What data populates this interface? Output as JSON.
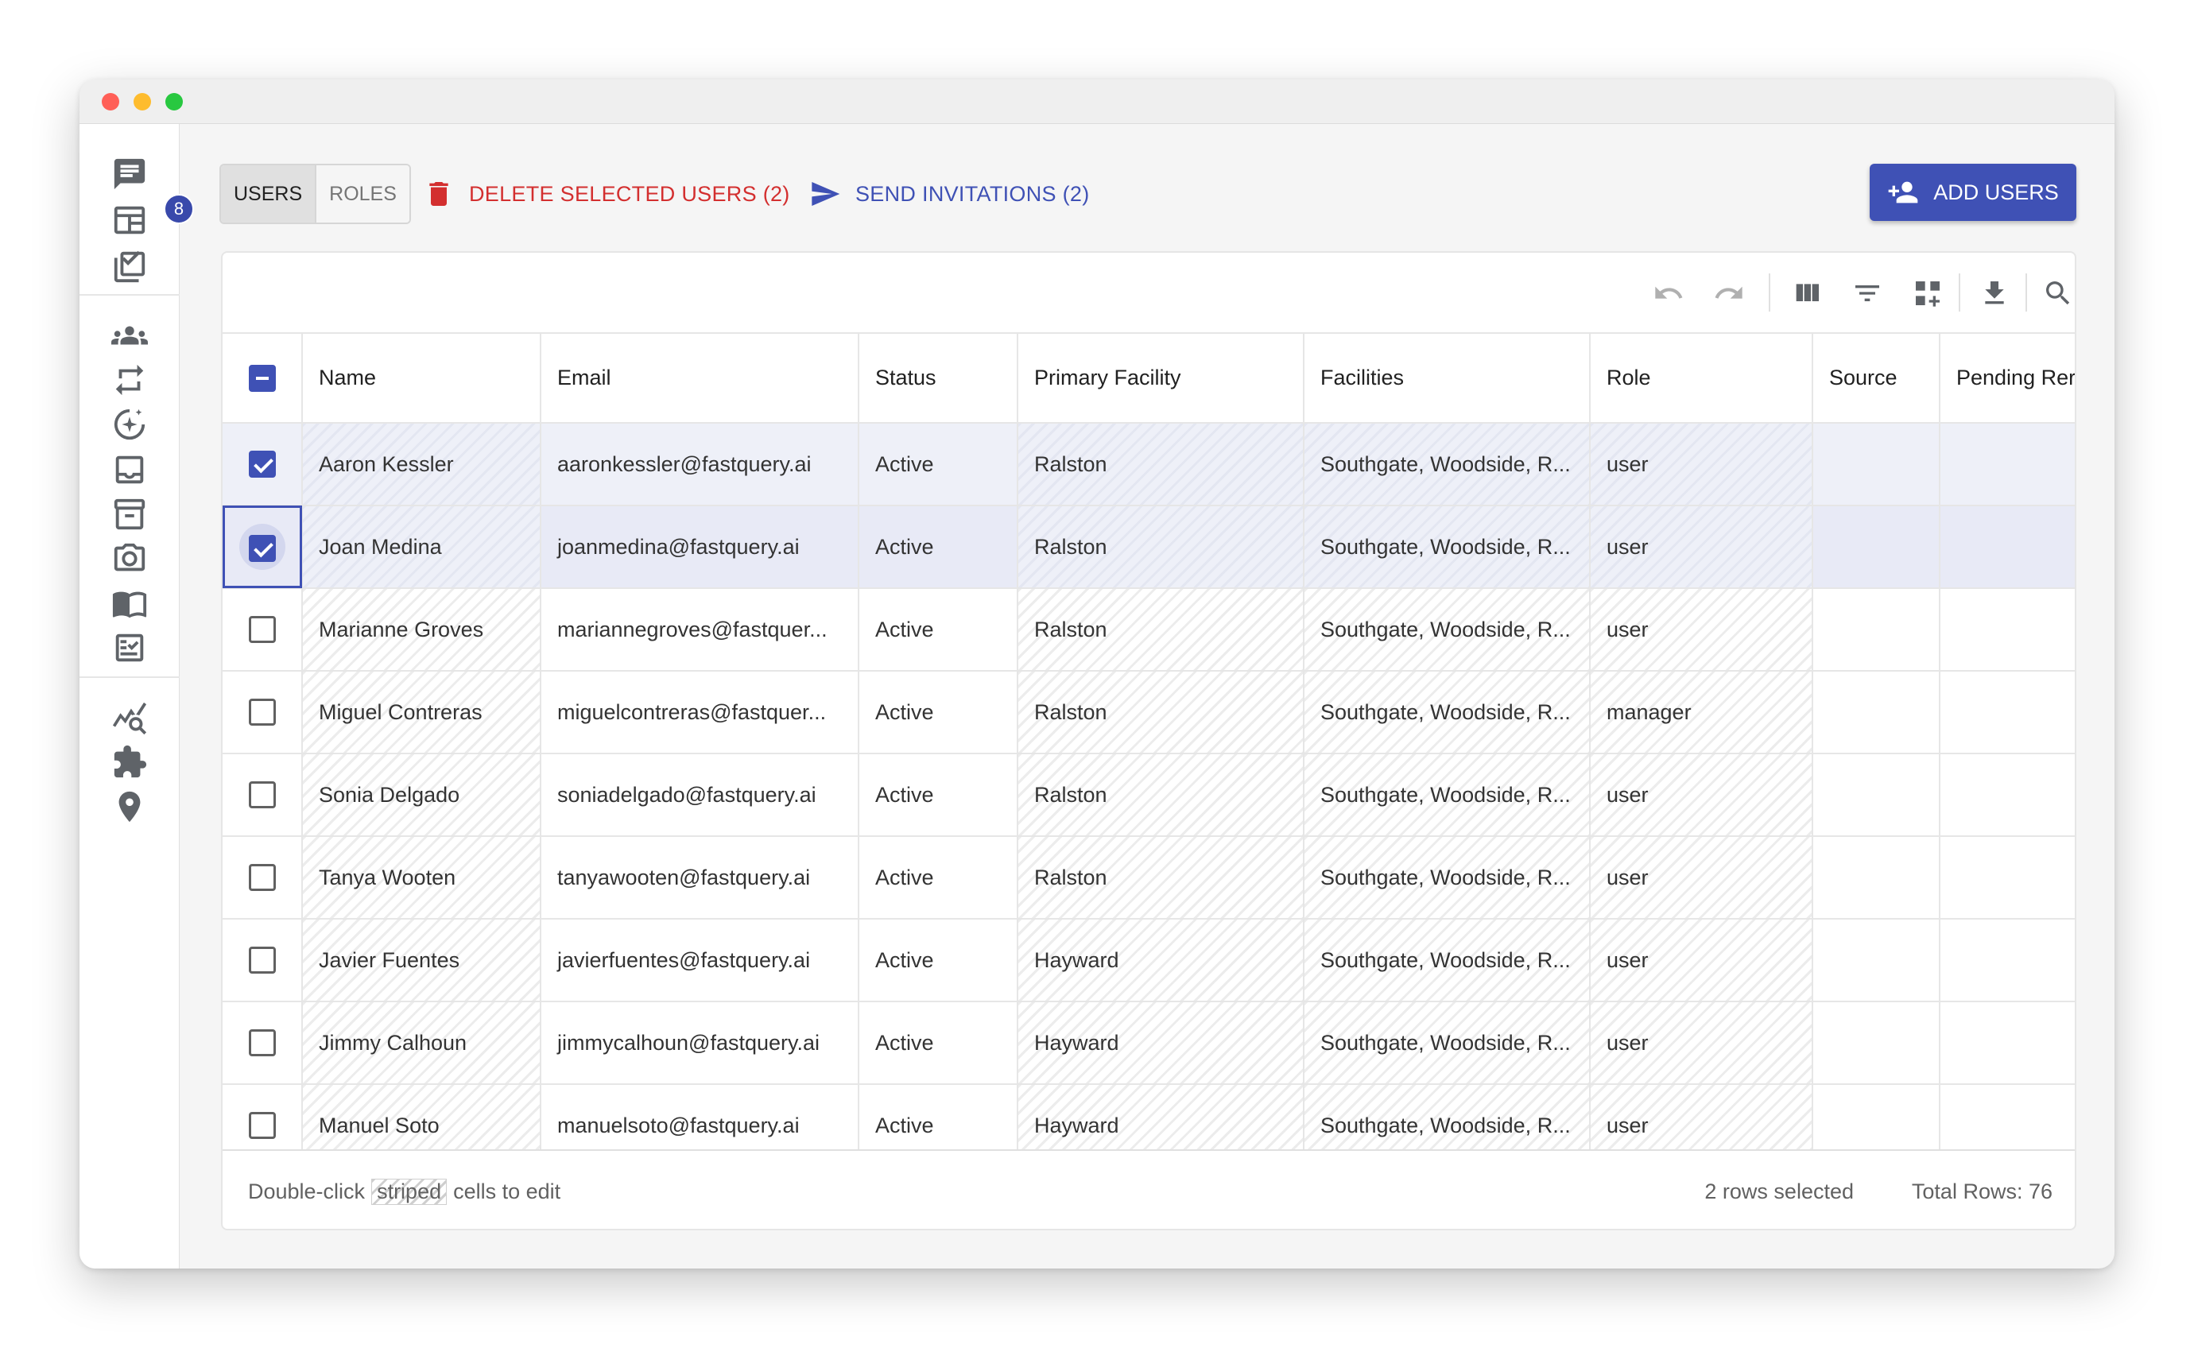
{
  "tabs": {
    "users": "USERS",
    "roles": "ROLES"
  },
  "actions": {
    "delete_label": "DELETE SELECTED USERS (2)",
    "invite_label": "SEND INVITATIONS (2)",
    "add_label": "ADD USERS"
  },
  "sidebar": {
    "badge_count": "8"
  },
  "columns": [
    "Name",
    "Email",
    "Status",
    "Primary Facility",
    "Facilities",
    "Role",
    "Source",
    "Pending Rer"
  ],
  "rows": [
    {
      "name": "Aaron Kessler",
      "email": "aaronkessler@fastquery.ai",
      "status": "Active",
      "primary": "Ralston",
      "facilities": "Southgate, Woodside, R...",
      "role": "user",
      "selected": true
    },
    {
      "name": "Joan Medina",
      "email": "joanmedina@fastquery.ai",
      "status": "Active",
      "primary": "Ralston",
      "facilities": "Southgate, Woodside, R...",
      "role": "user",
      "selected": true
    },
    {
      "name": "Marianne Groves",
      "email": "mariannegroves@fastquer...",
      "status": "Active",
      "primary": "Ralston",
      "facilities": "Southgate, Woodside, R...",
      "role": "user",
      "selected": false
    },
    {
      "name": "Miguel Contreras",
      "email": "miguelcontreras@fastquer...",
      "status": "Active",
      "primary": "Ralston",
      "facilities": "Southgate, Woodside, R...",
      "role": "manager",
      "selected": false
    },
    {
      "name": "Sonia Delgado",
      "email": "soniadelgado@fastquery.ai",
      "status": "Active",
      "primary": "Ralston",
      "facilities": "Southgate, Woodside, R...",
      "role": "user",
      "selected": false
    },
    {
      "name": "Tanya Wooten",
      "email": "tanyawooten@fastquery.ai",
      "status": "Active",
      "primary": "Ralston",
      "facilities": "Southgate, Woodside, R...",
      "role": "user",
      "selected": false
    },
    {
      "name": "Javier Fuentes",
      "email": "javierfuentes@fastquery.ai",
      "status": "Active",
      "primary": "Hayward",
      "facilities": "Southgate, Woodside, R...",
      "role": "user",
      "selected": false
    },
    {
      "name": "Jimmy Calhoun",
      "email": "jimmycalhoun@fastquery.ai",
      "status": "Active",
      "primary": "Hayward",
      "facilities": "Southgate, Woodside, R...",
      "role": "user",
      "selected": false
    },
    {
      "name": "Manuel Soto",
      "email": "manuelsoto@fastquery.ai",
      "status": "Active",
      "primary": "Hayward",
      "facilities": "Southgate, Woodside, R...",
      "role": "user",
      "selected": false
    }
  ],
  "footer": {
    "hint_prefix": "Double-click",
    "hint_striped": "striped",
    "hint_suffix": "cells to edit",
    "rows_selected": "2 rows selected",
    "total_rows": "Total Rows: 76"
  },
  "colors": {
    "accent": "#3f51b5",
    "danger": "#d32f2f"
  }
}
